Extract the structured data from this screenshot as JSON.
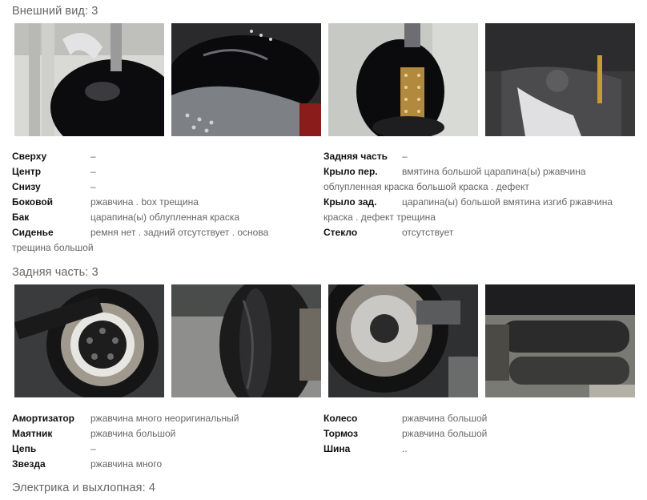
{
  "sections": [
    {
      "title": "Внешний вид",
      "count": "3",
      "photos": [
        "front-fender-photo",
        "rear-fender-seat-photo",
        "fuel-tank-photo",
        "engine-detail-photo"
      ],
      "left_specs": [
        {
          "label": "Сверху",
          "value": "–"
        },
        {
          "label": "Центр",
          "value": "–"
        },
        {
          "label": "Снизу",
          "value": "–"
        },
        {
          "label": "Боковой",
          "value": "ржавчина . box трещина"
        },
        {
          "label": "Бак",
          "value": "царапина(ы) облупленная краска"
        },
        {
          "label": "Сиденье",
          "value": "ремня нет . задний отсутствует . основа трещина большой"
        }
      ],
      "right_specs": [
        {
          "label": "Задняя часть",
          "value": "–"
        },
        {
          "label": "Крыло пер.",
          "value": "вмятина большой царапина(ы) ржавчина облупленная краска большой краска . дефект"
        },
        {
          "label": "Крыло зад.",
          "value": "царапина(ы) большой вмятина изгиб ржавчина краска . дефект трещина"
        },
        {
          "label": "Стекло",
          "value": "отсутствует"
        }
      ]
    },
    {
      "title": "Задняя часть",
      "count": "3",
      "photos": [
        "rear-wheel-photo",
        "rear-tire-photo",
        "brake-disc-photo",
        "exhaust-photo"
      ],
      "left_specs": [
        {
          "label": "Амортизатор",
          "value": "ржавчина много неоригинальный"
        },
        {
          "label": "Маятник",
          "value": "ржавчина большой"
        },
        {
          "label": "Цепь",
          "value": "–"
        },
        {
          "label": "Звезда",
          "value": "ржавчина много"
        }
      ],
      "right_specs": [
        {
          "label": "Колесо",
          "value": "ржавчина большой"
        },
        {
          "label": "Тормоз",
          "value": "ржавчина большой"
        },
        {
          "label": "Шина",
          "value": ".."
        }
      ]
    },
    {
      "title": "Электрика и выхлопная",
      "count": "4"
    }
  ]
}
